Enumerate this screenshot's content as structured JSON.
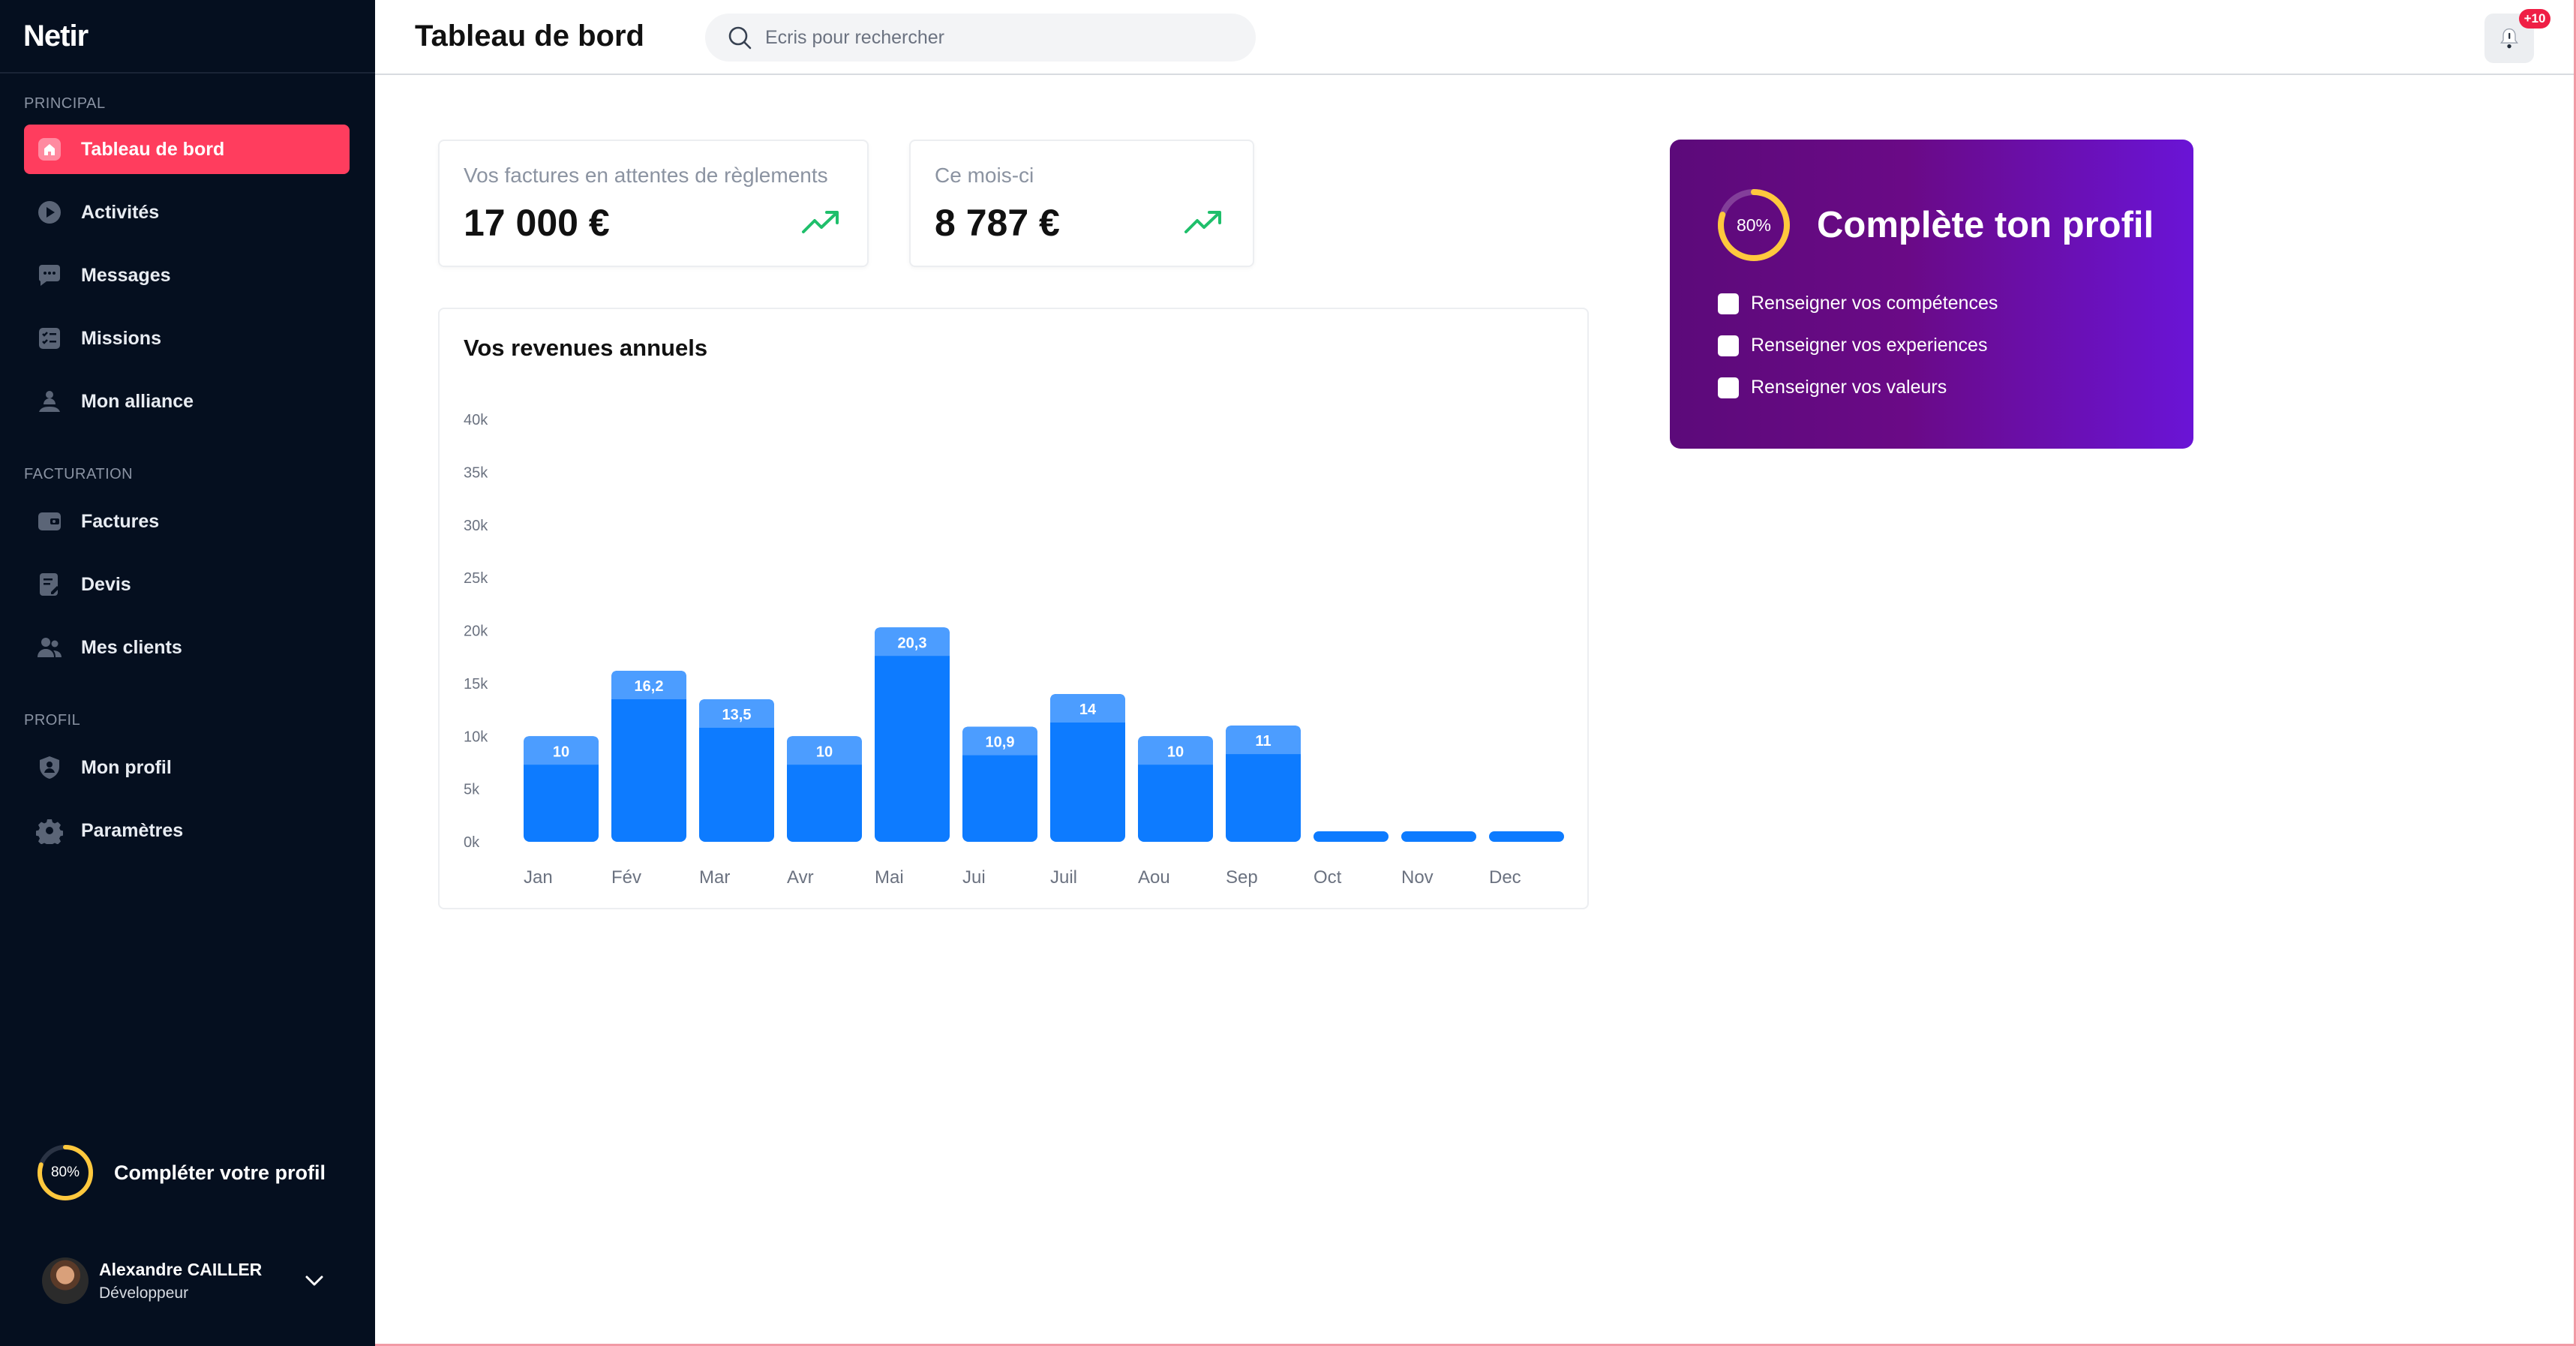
{
  "app": {
    "logo": "Netir"
  },
  "colors": {
    "sidebar_bg": "#050f1f",
    "accent": "#ff3d5e",
    "bar": "#0d7bff",
    "bar_top": "#4c9dff",
    "progress": "#ffc83d",
    "trend": "#1fbf6b",
    "badge": "#ef1f45",
    "profile_card_start": "#5c0a7a",
    "profile_card_end": "#6a14d6"
  },
  "sidebar": {
    "sections": [
      {
        "label": "PRINCIPAL",
        "items": [
          {
            "label": "Tableau de bord",
            "icon": "home-icon",
            "active": true
          },
          {
            "label": "Activités",
            "icon": "play-circle-icon",
            "active": false
          },
          {
            "label": "Messages",
            "icon": "chat-icon",
            "active": false
          },
          {
            "label": "Missions",
            "icon": "checklist-icon",
            "active": false
          },
          {
            "label": "Mon alliance",
            "icon": "people-icon",
            "active": false
          }
        ]
      },
      {
        "label": "FACTURATION",
        "items": [
          {
            "label": "Factures",
            "icon": "wallet-icon",
            "active": false
          },
          {
            "label": "Devis",
            "icon": "document-edit-icon",
            "active": false
          },
          {
            "label": "Mes clients",
            "icon": "users-icon",
            "active": false
          }
        ]
      },
      {
        "label": "PROFIL",
        "items": [
          {
            "label": "Mon profil",
            "icon": "shield-user-icon",
            "active": false
          },
          {
            "label": "Paramètres",
            "icon": "gear-icon",
            "active": false
          }
        ]
      }
    ],
    "profile_progress": {
      "percent_label": "80%",
      "value": 0.8,
      "label": "Compléter votre profil"
    },
    "user": {
      "name": "Alexandre CAILLER",
      "role": "Développeur"
    }
  },
  "header": {
    "title": "Tableau de bord",
    "search_placeholder": "Ecris pour rechercher",
    "notifications_badge": "+10"
  },
  "stats": [
    {
      "label": "Vos factures en attentes de règlements",
      "value": "17 000 €",
      "trend": "up"
    },
    {
      "label": "Ce mois-ci",
      "value": "8 787 €",
      "trend": "up"
    }
  ],
  "chart": {
    "title": "Vos revenues annuels"
  },
  "chart_data": {
    "type": "bar",
    "title": "Vos revenues annuels",
    "categories": [
      "Jan",
      "Fév",
      "Mar",
      "Avr",
      "Mai",
      "Jui",
      "Juil",
      "Aou",
      "Sep",
      "Oct",
      "Nov",
      "Dec"
    ],
    "values": [
      10,
      16.2,
      13.5,
      10,
      20.3,
      10.9,
      14,
      10,
      11,
      0,
      0,
      0
    ],
    "data_labels": [
      "10",
      "16,2",
      "13,5",
      "10",
      "20,3",
      "10,9",
      "14",
      "10",
      "11",
      "",
      "",
      ""
    ],
    "y_ticks": [
      "0k",
      "5k",
      "10k",
      "15k",
      "20k",
      "25k",
      "30k",
      "35k",
      "40k"
    ],
    "ylim": [
      0,
      40
    ],
    "unit": "k",
    "grid": false,
    "xlabel": "",
    "ylabel": ""
  },
  "profile_card": {
    "percent_label": "80%",
    "value": 0.8,
    "title": "Complète ton profil",
    "checklist": [
      {
        "label": "Renseigner vos compétences",
        "checked": false
      },
      {
        "label": "Renseigner vos experiences",
        "checked": false
      },
      {
        "label": "Renseigner vos valeurs",
        "checked": false
      }
    ]
  }
}
